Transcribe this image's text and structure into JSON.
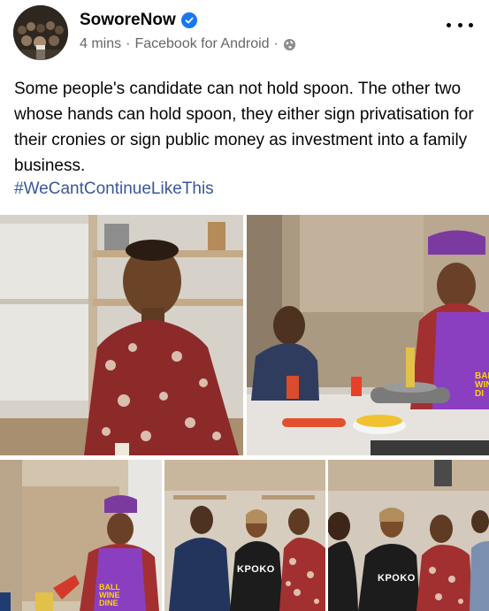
{
  "post": {
    "page_name": "SoworeNow",
    "time": "4 mins",
    "separator": "·",
    "source": "Facebook for Android",
    "separator2": "·",
    "text": "Some people's candidate can not hold spoon. The other two whose hands can hold spoon, they either sign privatisation for their cronies or sign public money as investment into a family business.",
    "hashtag": "#WeCantContinueLikeThis"
  },
  "icons": {
    "verified": "verified-badge-icon",
    "audience": "globe-icon",
    "more": "more-options-icon"
  },
  "photos": {
    "shirt_label_1": "KPOKO",
    "shirt_label_2": "KPOKO",
    "apron_lines_right": [
      "BAL",
      "WIN",
      "DI"
    ],
    "apron_lines_bottom": [
      "BALL",
      "WINE",
      "DINE"
    ]
  },
  "colors": {
    "link": "#385898",
    "verified": "#1877f2",
    "meta": "#65676b"
  }
}
